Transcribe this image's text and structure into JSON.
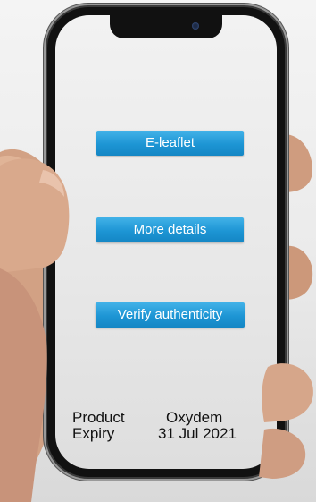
{
  "buttons": {
    "eleaflet": "E-leaflet",
    "more_details": "More details",
    "verify": "Verify authenticity"
  },
  "product_info": {
    "product_label": "Product",
    "product_value": "Oxydem",
    "expiry_label": "Expiry",
    "expiry_value": "31 Jul 2021"
  },
  "colors": {
    "button_blue": "#1d95d4",
    "phone_frame": "#111111",
    "screen_bg": "#ececec"
  }
}
